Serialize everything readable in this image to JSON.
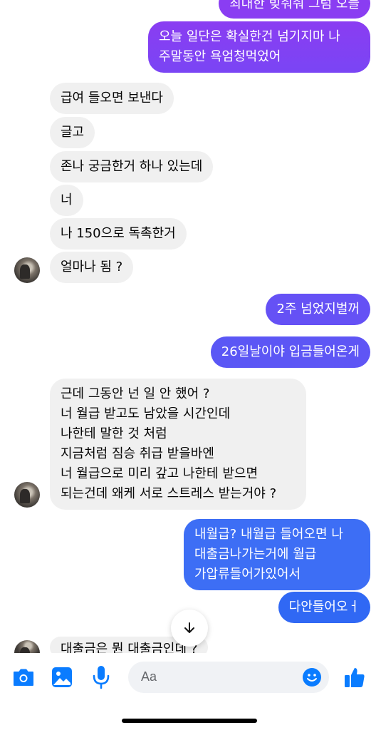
{
  "messages": [
    {
      "id": "m0",
      "side": "out",
      "text": "최대한 빚줘줘 그럼 오늘"
    },
    {
      "id": "m1",
      "side": "out",
      "text": "오늘 일단은 확실한건 넘기지마 나\n주말동안 욕엄청먹었어"
    },
    {
      "id": "m2",
      "side": "in",
      "text": "급여 들오면 보낸다"
    },
    {
      "id": "m3",
      "side": "in",
      "text": "글고"
    },
    {
      "id": "m4",
      "side": "in",
      "text": "존나 궁금한거 하나 있는데"
    },
    {
      "id": "m5",
      "side": "in",
      "text": "너"
    },
    {
      "id": "m6",
      "side": "in",
      "text": "나 150으로 독촉한거"
    },
    {
      "id": "m7",
      "side": "in",
      "text": "얼마나 됨 ?"
    },
    {
      "id": "m8",
      "side": "out",
      "text": "2주 넘었지벌꺼"
    },
    {
      "id": "m9",
      "side": "out",
      "text": "26일날이야 입금들어온게"
    },
    {
      "id": "m10",
      "side": "in",
      "text": "근데 그동안 넌 일 안 했어 ?\n너 월급 받고도 남았을 시간인데\n나한테 말한 것 처럼\n지금처럼 짐승 취급 받을바엔\n너 월급으로 미리 갚고 나한테 받으면\n되는건데 왜케 서로 스트레스 받는거야 ?"
    },
    {
      "id": "m11",
      "side": "out",
      "text": "내월급? 내월급 들어오면 나\n대출금나가는거에 월급\n가압류들어가있어서"
    },
    {
      "id": "m12",
      "side": "out",
      "text": "다안들어오ㅓ"
    },
    {
      "id": "m13",
      "side": "in",
      "text": "대출금은 뭔 대출금인데 ?"
    }
  ],
  "composer": {
    "placeholder": "Aa",
    "icons": [
      "camera-icon",
      "gallery-icon",
      "microphone-icon",
      "emoji-icon",
      "like-icon"
    ],
    "accent": "#0a7cff"
  },
  "scroll_button": {
    "icon": "arrow-down-icon"
  },
  "colors": {
    "incoming_bubble": "#f0f0f0",
    "outgoing_gradient": [
      "#8a3df2",
      "#6551f5",
      "#3d6ef5",
      "#3068f4"
    ]
  }
}
